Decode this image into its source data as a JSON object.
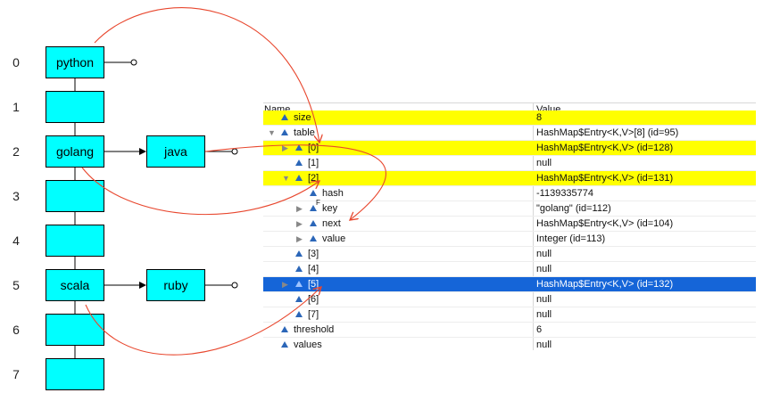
{
  "indices": [
    "0",
    "1",
    "2",
    "3",
    "4",
    "5",
    "6",
    "7"
  ],
  "buckets": [
    "python",
    "",
    "golang",
    "",
    "",
    "scala",
    "",
    ""
  ],
  "chain_nodes": [
    {
      "label": "java",
      "row": 2
    },
    {
      "label": "ruby",
      "row": 5
    }
  ],
  "debugger": {
    "col_name": "Name",
    "col_value": "Value",
    "rows": [
      {
        "name": "size",
        "value": "8",
        "indent": 0,
        "twisty": "",
        "hl": "yellow",
        "f": false
      },
      {
        "name": "table",
        "value": "HashMap$Entry<K,V>[8]  (id=95)",
        "indent": 0,
        "twisty": "open",
        "hl": "",
        "f": false
      },
      {
        "name": "[0]",
        "value": "HashMap$Entry<K,V>  (id=128)",
        "indent": 1,
        "twisty": "closed",
        "hl": "yellow",
        "f": false
      },
      {
        "name": "[1]",
        "value": "null",
        "indent": 1,
        "twisty": "",
        "hl": "",
        "f": false
      },
      {
        "name": "[2]",
        "value": "HashMap$Entry<K,V>  (id=131)",
        "indent": 1,
        "twisty": "open",
        "hl": "yellow",
        "f": false
      },
      {
        "name": "hash",
        "value": "-1139335774",
        "indent": 2,
        "twisty": "",
        "hl": "",
        "f": false
      },
      {
        "name": "key",
        "value": "\"golang\" (id=112)",
        "indent": 2,
        "twisty": "closed",
        "hl": "",
        "f": true
      },
      {
        "name": "next",
        "value": "HashMap$Entry<K,V>  (id=104)",
        "indent": 2,
        "twisty": "closed",
        "hl": "",
        "f": false
      },
      {
        "name": "value",
        "value": "Integer  (id=113)",
        "indent": 2,
        "twisty": "closed",
        "hl": "",
        "f": false
      },
      {
        "name": "[3]",
        "value": "null",
        "indent": 1,
        "twisty": "",
        "hl": "",
        "f": false
      },
      {
        "name": "[4]",
        "value": "null",
        "indent": 1,
        "twisty": "",
        "hl": "",
        "f": false
      },
      {
        "name": "[5]",
        "value": "HashMap$Entry<K,V>  (id=132)",
        "indent": 1,
        "twisty": "closed",
        "hl": "blue",
        "f": false
      },
      {
        "name": "[6]",
        "value": "null",
        "indent": 1,
        "twisty": "",
        "hl": "",
        "f": false
      },
      {
        "name": "[7]",
        "value": "null",
        "indent": 1,
        "twisty": "",
        "hl": "",
        "f": false
      },
      {
        "name": "threshold",
        "value": "6",
        "indent": 0,
        "twisty": "",
        "hl": "",
        "f": false
      },
      {
        "name": "values",
        "value": "null",
        "indent": 0,
        "twisty": "",
        "hl": "",
        "f": false
      }
    ]
  },
  "colors": {
    "node_fill": "#00ffff",
    "arrow": "#e8472e",
    "row_yellow": "#ffff00",
    "row_selected": "#1565d8",
    "tree_icon": "#2b66b8"
  }
}
